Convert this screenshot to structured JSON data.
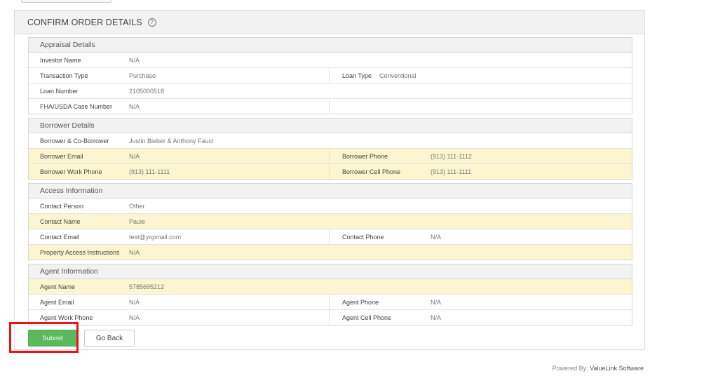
{
  "panel": {
    "title": "CONFIRM ORDER DETAILS",
    "help_icon": "?"
  },
  "appraisal": {
    "title": "Appraisal Details",
    "investor_name": {
      "label": "Investor Name",
      "value": "N/A"
    },
    "transaction_type": {
      "label": "Transaction Type",
      "value": "Purchase"
    },
    "loan_type": {
      "label": "Loan Type",
      "value": "Conventional"
    },
    "loan_number": {
      "label": "Loan Number",
      "value": "2105000518"
    },
    "case_number": {
      "label": "FHA/USDA Case Number",
      "value": "N/A"
    }
  },
  "borrower": {
    "title": "Borrower Details",
    "names": {
      "label": "Borrower & Co-Borrower",
      "value": "Justin Bieber & Anthony Fauci"
    },
    "email": {
      "label": "Borrower Email",
      "value": "N/A"
    },
    "phone": {
      "label": "Borrower Phone",
      "value": "(913) 111-1112"
    },
    "work_phone": {
      "label": "Borrower Work Phone",
      "value": "(913) 111-1111"
    },
    "cell_phone": {
      "label": "Borrower Cell Phone",
      "value": "(913) 111-1111"
    }
  },
  "access": {
    "title": "Access Information",
    "contact_person": {
      "label": "Contact Person",
      "value": "Other"
    },
    "contact_name": {
      "label": "Contact Name",
      "value": "Pauie"
    },
    "contact_email": {
      "label": "Contact Email",
      "value": "test@yopmail.com"
    },
    "contact_phone": {
      "label": "Contact Phone",
      "value": "N/A"
    },
    "instructions": {
      "label": "Property Access Instructions",
      "value": "N/A"
    }
  },
  "agent": {
    "title": "Agent Information",
    "name": {
      "label": "Agent Name",
      "value": "5785695212"
    },
    "email": {
      "label": "Agent Email",
      "value": "N/A"
    },
    "phone": {
      "label": "Agent Phone",
      "value": "N/A"
    },
    "work_phone": {
      "label": "Agent Work Phone",
      "value": "N/A"
    },
    "cell_phone": {
      "label": "Agent Cell Phone",
      "value": "N/A"
    }
  },
  "buttons": {
    "submit": "Submit",
    "back": "Go Back"
  },
  "footer": {
    "prefix": "Powered By:",
    "brand": "ValueLink Software"
  },
  "colors": {
    "submit": "#5cb85c",
    "highlight_row": "#fbf6d0",
    "annotation_box": "#e8121d"
  }
}
